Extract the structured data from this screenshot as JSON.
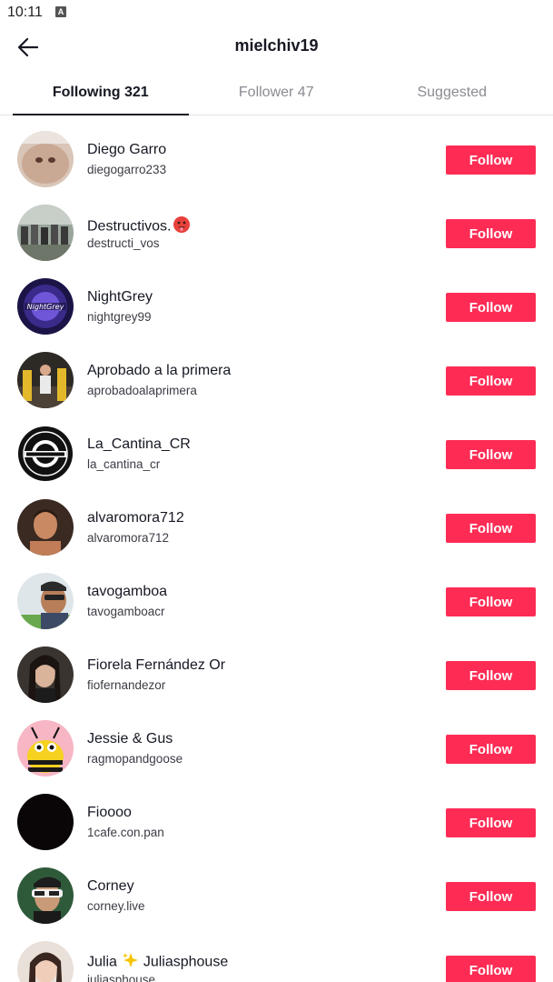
{
  "status_bar": {
    "time": "10:11",
    "indicator": "A"
  },
  "header": {
    "title": "mielchiv19",
    "back_icon": "arrow-left-icon"
  },
  "tabs": [
    {
      "label": "Following 321",
      "active": true
    },
    {
      "label": "Follower 47",
      "active": false
    },
    {
      "label": "Suggested",
      "active": false
    }
  ],
  "colors": {
    "accent": "#fe2c55",
    "text": "#161823",
    "muted": "#8a8b91"
  },
  "users": [
    {
      "name": "Diego Garro",
      "handle": "diegogarro233",
      "button": "Follow"
    },
    {
      "name": "Destructivos.",
      "handle": "destructi_vos",
      "button": "Follow",
      "emoji_icon": "hot-face-emoji-icon"
    },
    {
      "name": "NightGrey",
      "handle": "nightgrey99",
      "button": "Follow"
    },
    {
      "name": "Aprobado a la primera",
      "handle": "aprobadoalaprimera",
      "button": "Follow"
    },
    {
      "name": "La_Cantina_CR",
      "handle": "la_cantina_cr",
      "button": "Follow"
    },
    {
      "name": "alvaromora712",
      "handle": "alvaromora712",
      "button": "Follow"
    },
    {
      "name": "tavogamboa",
      "handle": "tavogamboacr",
      "button": "Follow"
    },
    {
      "name": "Fiorela Fernández Or",
      "handle": "fiofernandezor",
      "button": "Follow"
    },
    {
      "name": "Jessie & Gus",
      "handle": "ragmopandgoose",
      "button": "Follow"
    },
    {
      "name": "Fioooo",
      "handle": "1cafe.con.pan",
      "button": "Follow"
    },
    {
      "name": "Corney",
      "handle": "corney.live",
      "button": "Follow"
    },
    {
      "name": "Julia",
      "name_suffix": "Juliasphouse",
      "handle": "juliasphouse",
      "button": "Follow",
      "emoji_icon": "sparkles-emoji-icon"
    }
  ]
}
